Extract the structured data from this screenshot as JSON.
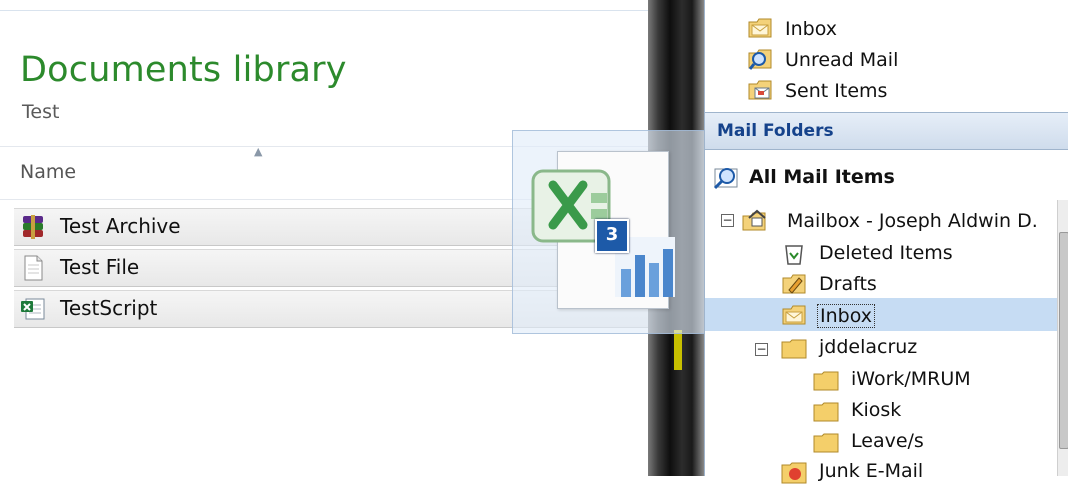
{
  "explorer": {
    "library_title": "Documents library",
    "library_subtitle": "Test",
    "column_name": "Name",
    "files": [
      {
        "name": "Test Archive",
        "icon": "winrar-archive-icon"
      },
      {
        "name": "Test File",
        "icon": "text-file-icon"
      },
      {
        "name": "TestScript",
        "icon": "excel-script-icon"
      }
    ]
  },
  "drag": {
    "icon": "excel-file-icon",
    "count": "3"
  },
  "outlook": {
    "favorites": [
      {
        "label": "Inbox",
        "icon": "inbox-envelope-icon"
      },
      {
        "label": "Unread Mail",
        "icon": "search-folder-icon"
      },
      {
        "label": "Sent Items",
        "icon": "sent-items-icon"
      }
    ],
    "mail_folders_header": "Mail Folders",
    "all_mail_items": "All Mail Items",
    "tree": {
      "mailbox": "Mailbox - Joseph Aldwin D.",
      "deleted": "Deleted Items",
      "drafts": "Drafts",
      "inbox": "Inbox",
      "user_folder": "jddelacruz",
      "subfolders": [
        "iWork/MRUM",
        "Kiosk",
        "Leave/s"
      ],
      "junk": "Junk E-Mail"
    },
    "selected_folder": "Inbox"
  },
  "colors": {
    "library_title": "#2c8a2c",
    "selection": "#c6dcf3",
    "header_text": "#15428b",
    "badge": "#1d5aa8"
  }
}
